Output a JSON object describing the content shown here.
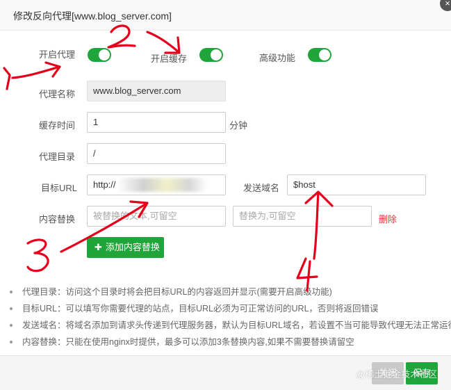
{
  "dialog": {
    "title": "修改反向代理[www.blog_server.com]",
    "close_symbol": "×"
  },
  "toggles": {
    "proxy": {
      "label": "开启代理",
      "on": true
    },
    "cache": {
      "label": "开启缓存",
      "on": true
    },
    "advanced": {
      "label": "高级功能",
      "on": true
    }
  },
  "form": {
    "proxy_name": {
      "label": "代理名称",
      "value": "www.blog_server.com"
    },
    "cache_time": {
      "label": "缓存时间",
      "value": "1",
      "unit": "分钟"
    },
    "proxy_dir": {
      "label": "代理目录",
      "value": "/"
    },
    "target_url": {
      "label": "目标URL",
      "value": "http://"
    },
    "send_domain": {
      "label": "发送域名",
      "value": "$host"
    },
    "content_replace": {
      "label": "内容替换",
      "from_placeholder": "被替换的文本,可留空",
      "to_placeholder": "替换为,可留空",
      "delete_label": "删除"
    },
    "add_replace_button": {
      "icon": "plus-icon",
      "label": "添加内容替换"
    }
  },
  "notes": [
    "代理目录：访问这个目录时将会把目标URL的内容返回并显示(需要开启高级功能)",
    "目标URL：可以填写你需要代理的站点，目标URL必须为可正常访问的URL，否则将返回错误",
    "发送域名：将域名添加到请求头传递到代理服务器，默认为目标URL域名，若设置不当可能导致代理无法正常运行",
    "内容替换：只能在使用nginx时提供，最多可以添加3条替换内容,如果不需要替换请留空"
  ],
  "footer": {
    "close_label": "关闭",
    "save_label": "保存"
  },
  "watermark": "@稀土掘金技术社区",
  "annotations": [
    "1",
    "2",
    "3",
    "4"
  ],
  "colors": {
    "accent_green": "#20a53a",
    "delete_red": "#e4393c",
    "annotation_red": "#e4001b"
  }
}
